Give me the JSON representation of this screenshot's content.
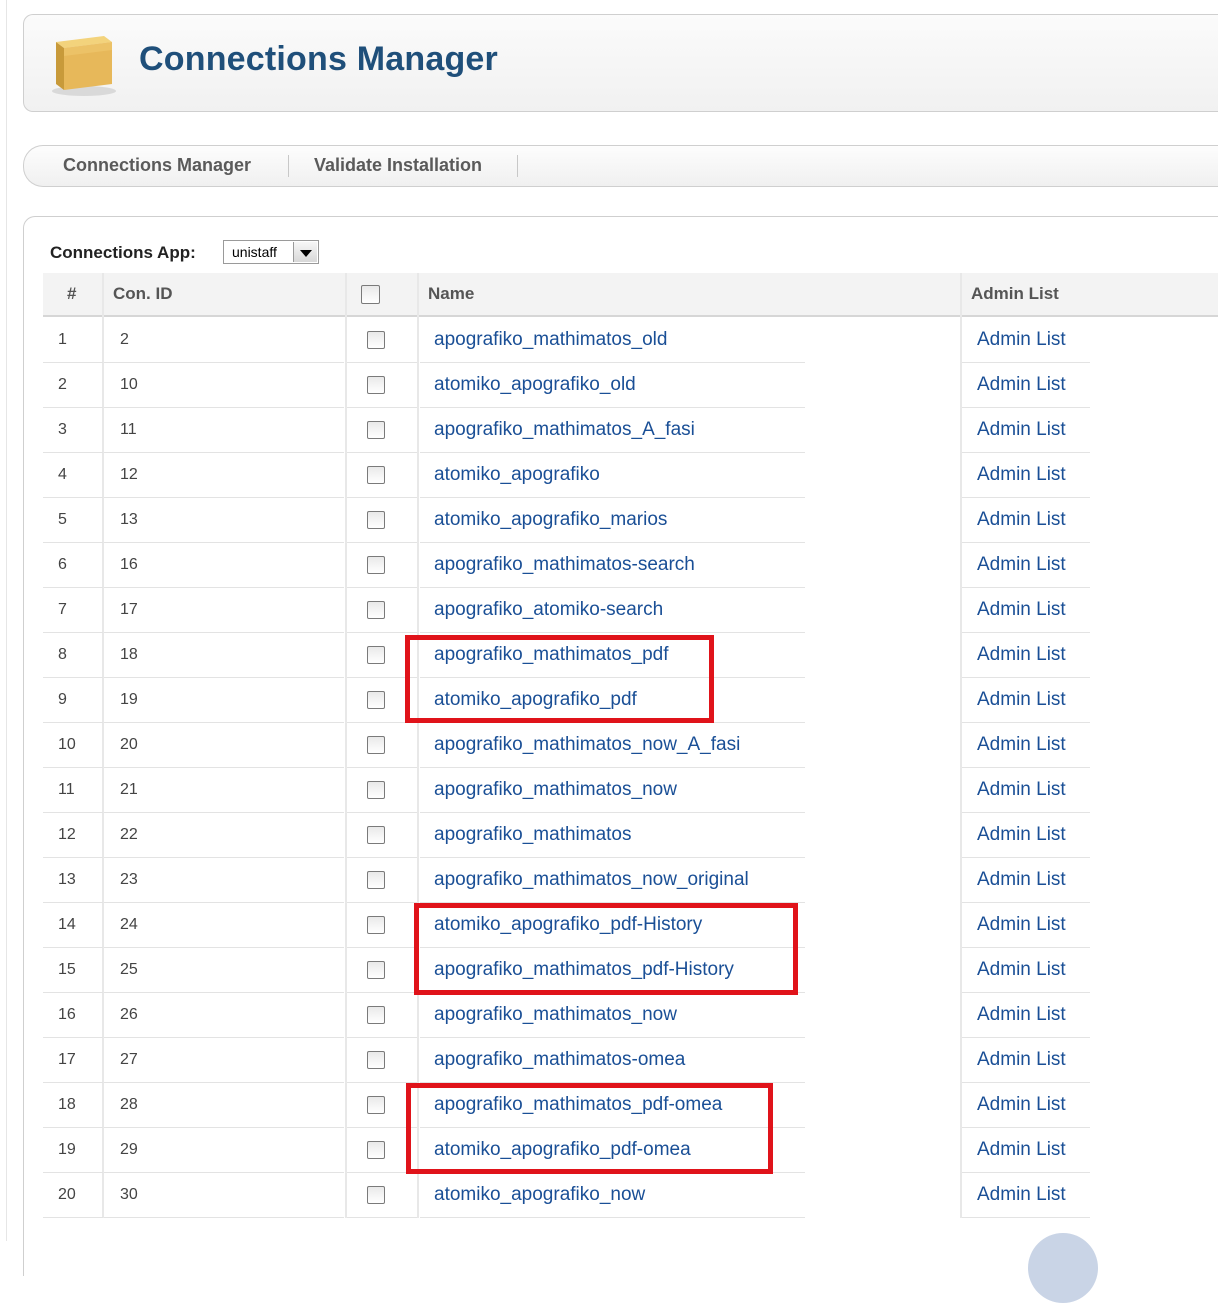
{
  "header": {
    "title": "Connections Manager",
    "icon": "package-box-icon"
  },
  "toolbar": {
    "items": [
      "Connections Manager",
      "Validate Installation"
    ]
  },
  "app_selector": {
    "label": "Connections App:",
    "value": "unistaff"
  },
  "table": {
    "headers": {
      "num": "#",
      "con_id": "Con. ID",
      "name": "Name",
      "admin": "Admin List"
    },
    "rows": [
      {
        "num": "1",
        "id": "2",
        "name": "apografiko_mathimatos_old",
        "admin": "Admin List"
      },
      {
        "num": "2",
        "id": "10",
        "name": "atomiko_apografiko_old",
        "admin": "Admin List"
      },
      {
        "num": "3",
        "id": "11",
        "name": "apografiko_mathimatos_A_fasi",
        "admin": "Admin List"
      },
      {
        "num": "4",
        "id": "12",
        "name": "atomiko_apografiko",
        "admin": "Admin List"
      },
      {
        "num": "5",
        "id": "13",
        "name": "atomiko_apografiko_marios",
        "admin": "Admin List"
      },
      {
        "num": "6",
        "id": "16",
        "name": "apografiko_mathimatos-search",
        "admin": "Admin List"
      },
      {
        "num": "7",
        "id": "17",
        "name": "apografiko_atomiko-search",
        "admin": "Admin List"
      },
      {
        "num": "8",
        "id": "18",
        "name": "apografiko_mathimatos_pdf",
        "admin": "Admin List"
      },
      {
        "num": "9",
        "id": "19",
        "name": "atomiko_apografiko_pdf",
        "admin": "Admin List"
      },
      {
        "num": "10",
        "id": "20",
        "name": "apografiko_mathimatos_now_A_fasi",
        "admin": "Admin List"
      },
      {
        "num": "11",
        "id": "21",
        "name": "apografiko_mathimatos_now",
        "admin": "Admin List"
      },
      {
        "num": "12",
        "id": "22",
        "name": "apografiko_mathimatos",
        "admin": "Admin List"
      },
      {
        "num": "13",
        "id": "23",
        "name": "apografiko_mathimatos_now_original",
        "admin": "Admin List"
      },
      {
        "num": "14",
        "id": "24",
        "name": "atomiko_apografiko_pdf-History",
        "admin": "Admin List"
      },
      {
        "num": "15",
        "id": "25",
        "name": "apografiko_mathimatos_pdf-History",
        "admin": "Admin List"
      },
      {
        "num": "16",
        "id": "26",
        "name": "apografiko_mathimatos_now",
        "admin": "Admin List"
      },
      {
        "num": "17",
        "id": "27",
        "name": "apografiko_mathimatos-omea",
        "admin": "Admin List"
      },
      {
        "num": "18",
        "id": "28",
        "name": "apografiko_mathimatos_pdf-omea",
        "admin": "Admin List"
      },
      {
        "num": "19",
        "id": "29",
        "name": "atomiko_apografiko_pdf-omea",
        "admin": "Admin List"
      },
      {
        "num": "20",
        "id": "30",
        "name": "atomiko_apografiko_now",
        "admin": "Admin List"
      }
    ]
  },
  "highlight_color": "#e0131a",
  "link_color": "#1a4f96",
  "title_color": "#1f4f7a"
}
